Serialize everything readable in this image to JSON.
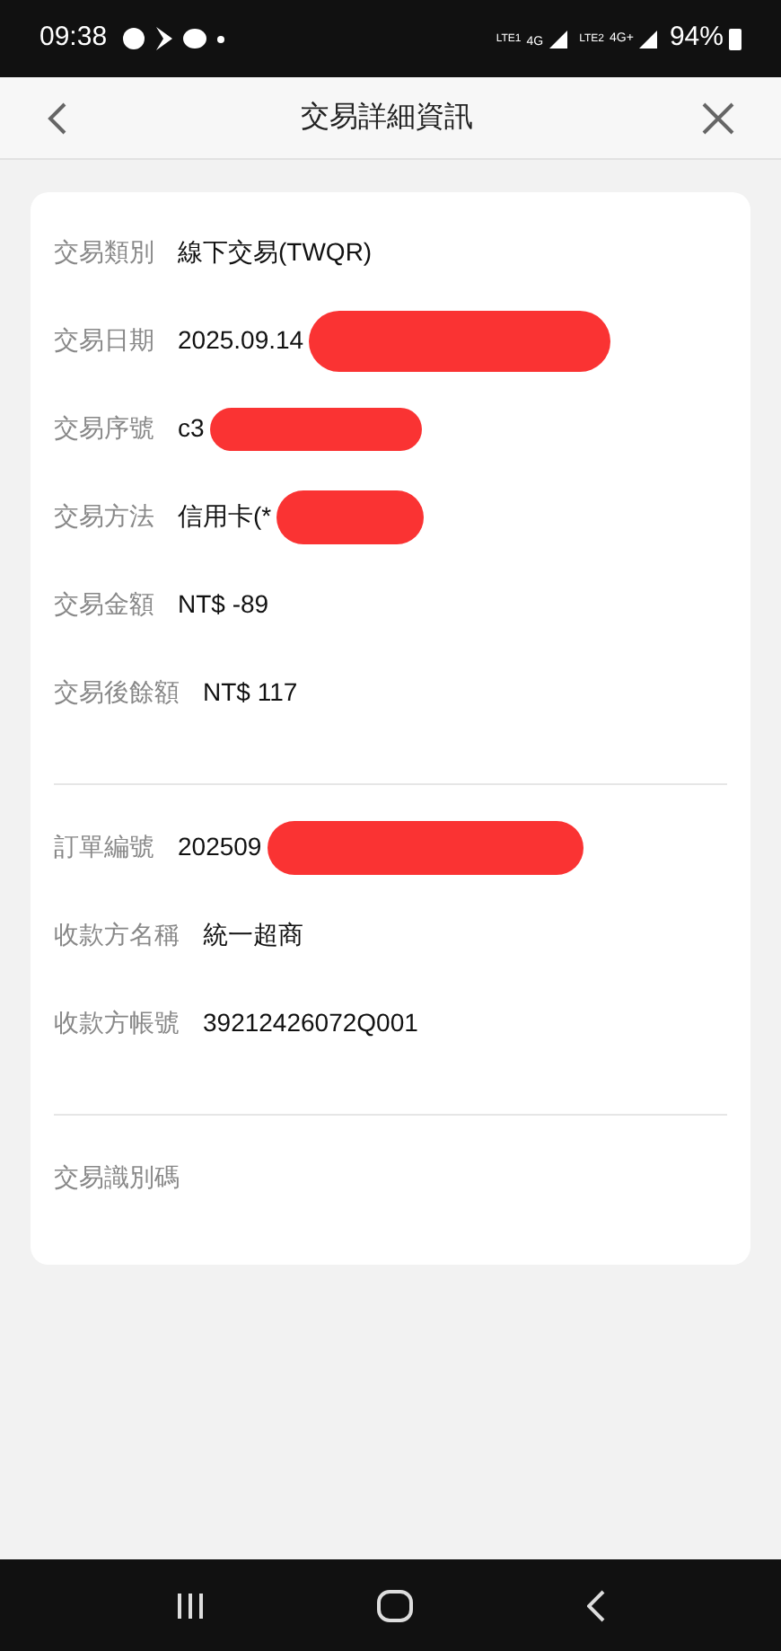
{
  "status_bar": {
    "time": "09:38",
    "sim1_label": "LTE1",
    "sim1_network": "4G",
    "sim2_label": "LTE2",
    "sim2_network": "4G+",
    "battery": "94%"
  },
  "header": {
    "title": "交易詳細資訊"
  },
  "sections": [
    {
      "rows": [
        {
          "label": "交易類別",
          "value": "線下交易(TWQR)",
          "redacted": false
        },
        {
          "label": "交易日期",
          "value": "2025.09.14",
          "redacted": true
        },
        {
          "label": "交易序號",
          "value": "c3",
          "redacted": true
        },
        {
          "label": "交易方法",
          "value": "信用卡(*",
          "redacted": true
        },
        {
          "label": "交易金額",
          "value": "NT$ -89",
          "redacted": false
        },
        {
          "label": "交易後餘額",
          "value": "NT$ 117",
          "redacted": false
        }
      ]
    },
    {
      "rows": [
        {
          "label": "訂單編號",
          "value": "202509",
          "redacted": true
        },
        {
          "label": "收款方名稱",
          "value": "統一超商",
          "redacted": false
        },
        {
          "label": "收款方帳號",
          "value": "39212426072Q001",
          "redacted": false
        }
      ]
    },
    {
      "rows": [
        {
          "label": "交易識別碼"
        }
      ]
    }
  ]
}
